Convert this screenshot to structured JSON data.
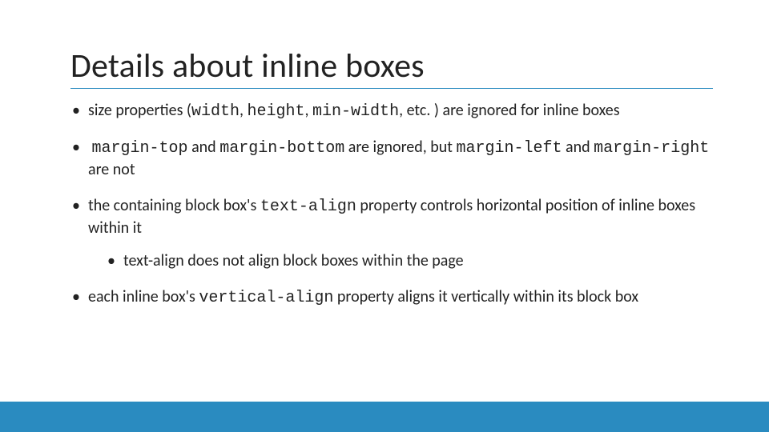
{
  "title": "Details about inline boxes",
  "bullets": {
    "b1": {
      "pre": "size properties (",
      "c1": "width",
      "sep1": ", ",
      "c2": "height",
      "sep2": ", ",
      "c3": "min-width",
      "post": ", etc. ) are ignored for inline boxes"
    },
    "b2": {
      "c1": "margin-top",
      "t1": " and ",
      "c2": "margin-bottom",
      "t2": " are ignored, but ",
      "c3": "margin-left",
      "t3": " and ",
      "c4": "margin-right",
      "t4": " are not"
    },
    "b3": {
      "t1": "the containing block box's ",
      "c1": "text-align",
      "t2": " property controls horizontal position of inline boxes within it"
    },
    "b3sub": {
      "t1": "text-align does not align block boxes within the page"
    },
    "b4": {
      "t1": "each inline box's ",
      "c1": "vertical-align",
      "t2": " property aligns it vertically within its block box"
    }
  }
}
